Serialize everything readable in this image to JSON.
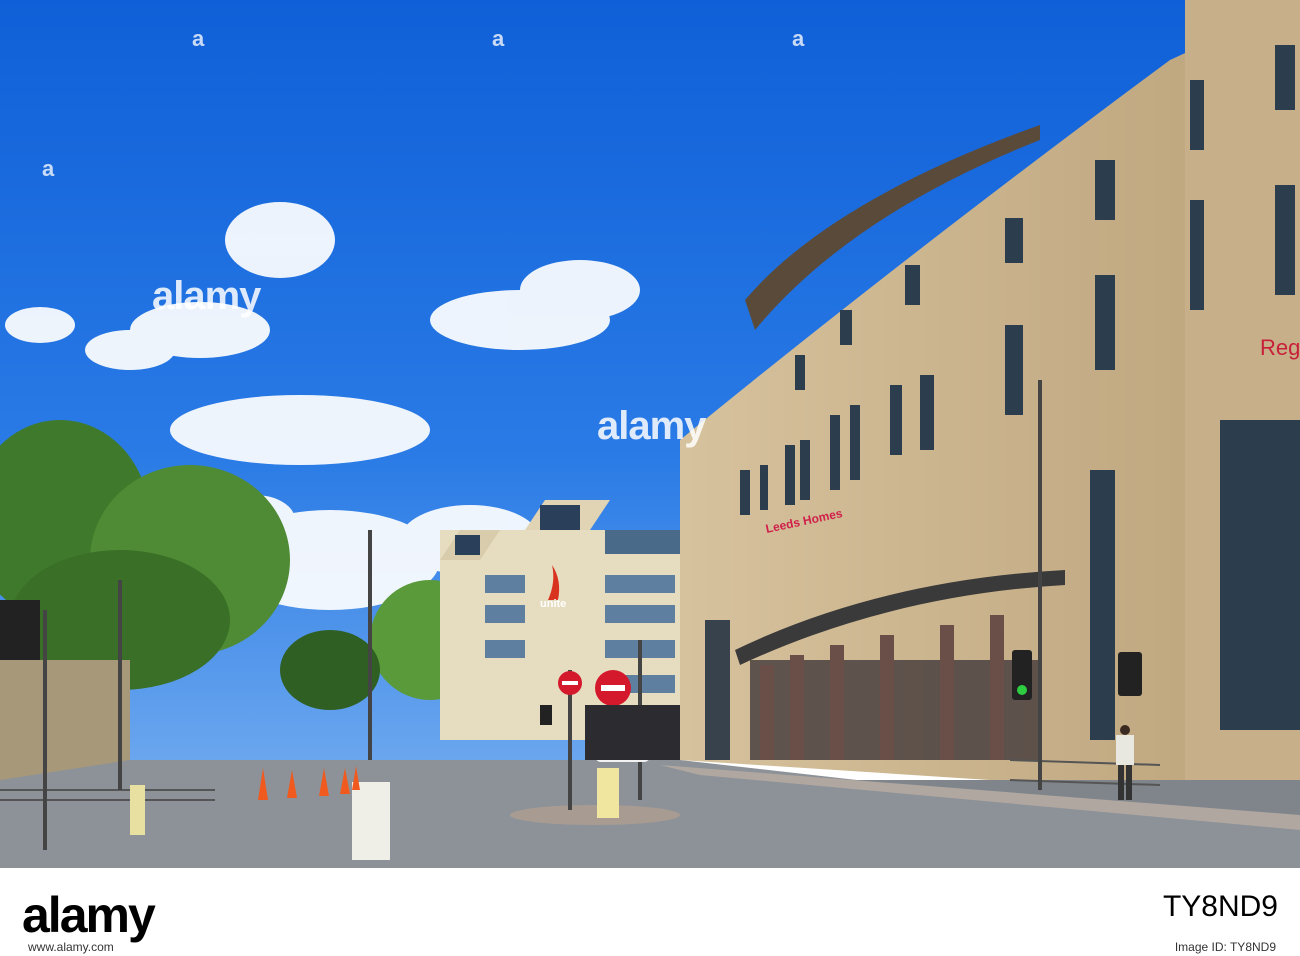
{
  "image": {
    "alt": "Street scene with a curved sandstone Regent House building, road works cones and a Unite office block under blue sky"
  },
  "watermarks": [
    "alamy",
    "alamy",
    "a",
    "a",
    "a",
    "a"
  ],
  "signage": {
    "building_sign": "Reg Hon",
    "entrance_sign": "Leeds Homes",
    "office_sign": "unite"
  },
  "footer": {
    "brand": "alamy",
    "image_id": "TY8ND9",
    "caption": "www.alamy.com",
    "image_id_label": "Image ID: TY8ND9"
  },
  "colors": {
    "sky": "#1a6fe0",
    "stone": "#c9b48e",
    "road": "#8a8f94"
  }
}
